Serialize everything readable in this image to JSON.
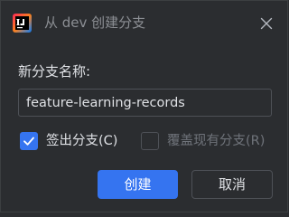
{
  "window": {
    "title": "从 dev 创建分支",
    "app_icon": "intellij-idea-icon",
    "close_icon": "close-icon"
  },
  "form": {
    "name_label": "新分支名称:",
    "branch_name_value": "feature-learning-records",
    "checkout_label": "签出分支(C)",
    "checkout_checked": true,
    "overwrite_label": "覆盖现有分支(R)",
    "overwrite_checked": false,
    "overwrite_enabled": false
  },
  "buttons": {
    "create_label": "创建",
    "cancel_label": "取消"
  },
  "colors": {
    "background": "#2b2d30",
    "accent": "#3574f0",
    "text": "#dfe1e5",
    "muted_text": "#8c8f94",
    "disabled_text": "#6f737a",
    "border": "#4e5157"
  }
}
